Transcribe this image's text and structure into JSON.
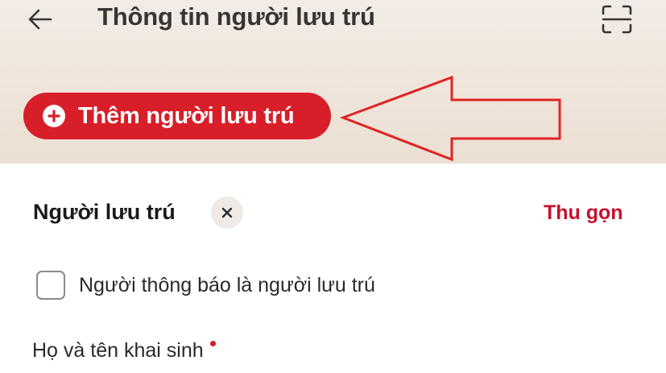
{
  "header": {
    "title": "Thông tin người lưu trú",
    "back_icon": "arrow-left-icon",
    "scan_icon": "scan-frame-icon"
  },
  "add_resident_button": {
    "label": "Thêm người lưu trú",
    "icon": "plus-circle-icon",
    "color": "#d81e28"
  },
  "annotation": {
    "icon": "pointer-arrow-icon",
    "color": "#e02424"
  },
  "resident_section": {
    "title": "Người lưu trú",
    "remove_icon": "close-icon",
    "collapse_label": "Thu gọn",
    "collapse_color": "#c8102e",
    "checkbox_label": "Người thông báo là người lưu trú",
    "checkbox_checked": false,
    "field_label": "Họ và tên khai sinh",
    "field_required": true
  }
}
